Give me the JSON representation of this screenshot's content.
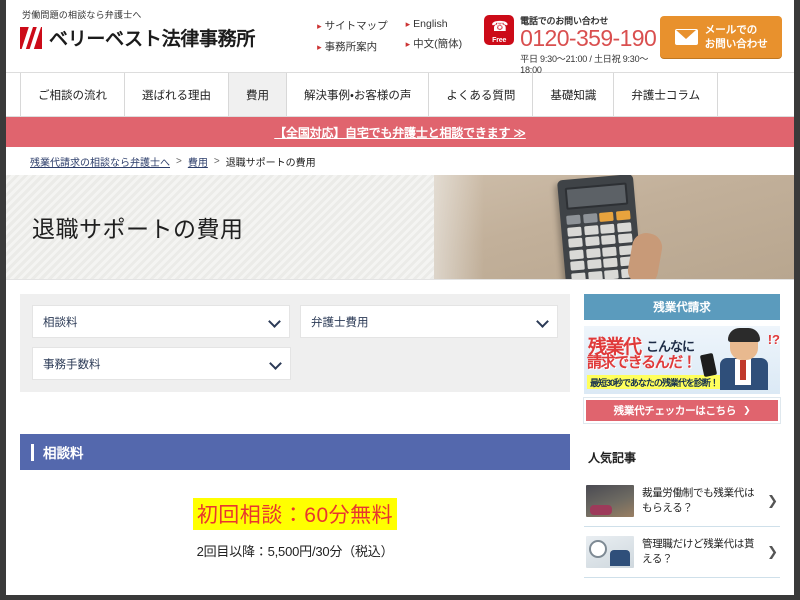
{
  "header": {
    "tagline": "労働問題の相談なら弁護士へ",
    "brand_name": "ベリーベスト法律事務所",
    "logo_icon": "berrybest-logo-icon",
    "links_col1": [
      "サイトマップ",
      "事務所案内"
    ],
    "links_col2": [
      "English",
      "中文(簡体)"
    ],
    "tel_label": "電話でのお問い合わせ",
    "tel_number": "0120-359-190",
    "tel_hours": "平日 9:30～21:00 / 土日祝 9:30～18:00",
    "free_badge": "Free",
    "phone_icon": "phone-handset-icon",
    "mail_icon": "envelope-icon",
    "mail_button_line1": "メールでの",
    "mail_button_line2": "お問い合わせ"
  },
  "nav": {
    "items": [
      {
        "label": "ご相談の流れ",
        "active": false
      },
      {
        "label": "選ばれる理由",
        "active": false
      },
      {
        "label": "費用",
        "active": true
      },
      {
        "label": "解決事例・お客様の声",
        "active": false
      },
      {
        "label": "よくある質問",
        "active": false
      },
      {
        "label": "基礎知識",
        "active": false
      },
      {
        "label": "弁護士コラム",
        "active": false
      }
    ]
  },
  "promo_bar": {
    "text": "【全国対応】自宅でも弁護士と相談できます ≫"
  },
  "breadcrumb": {
    "items": [
      "残業代請求の相談なら弁護士へ",
      "費用",
      "退職サポートの費用"
    ],
    "separator": ">"
  },
  "hero": {
    "title": "退職サポートの費用",
    "image_alt": "calculator-photo"
  },
  "filters": {
    "selects": [
      {
        "value": "相談料"
      },
      {
        "value": "弁護士費用"
      },
      {
        "value": "事務手数料"
      }
    ],
    "chevron_icon": "chevron-down-icon"
  },
  "section": {
    "heading": "相談料",
    "price_free": "初回相談：60分無料",
    "price_sub": "2回目以降：5,500円/30分（税込）"
  },
  "sidebar": {
    "heading": "残業代請求",
    "banner": {
      "big_red": "残業代",
      "dark_1": "こんなに",
      "red_2": "請求できるんだ！",
      "strip": "最短30秒であなたの残業代を診断！",
      "exclaim": "!?",
      "person_icon": "businessman-icon"
    },
    "cta": {
      "label": "残業代チェッカーはこちら",
      "arrow_icon": "chevron-right-icon"
    },
    "popular_heading": "人気記事",
    "popular_items": [
      {
        "title": "裁量労働制でも残業代はもらえる？",
        "thumb": "sleeping-worker-thumb"
      },
      {
        "title": "管理職だけど残業代は貰える？",
        "thumb": "clock-money-thumb"
      }
    ],
    "arrow_icon": "chevron-right-icon"
  },
  "colors": {
    "brand_red": "#cc0b18",
    "accent_orange": "#e8912d",
    "promo_red": "#e0646e",
    "section_blue": "#5468ad",
    "sidebar_blue": "#5b9bbd",
    "highlight_yellow": "#ffff00",
    "price_red": "#e8362f"
  }
}
